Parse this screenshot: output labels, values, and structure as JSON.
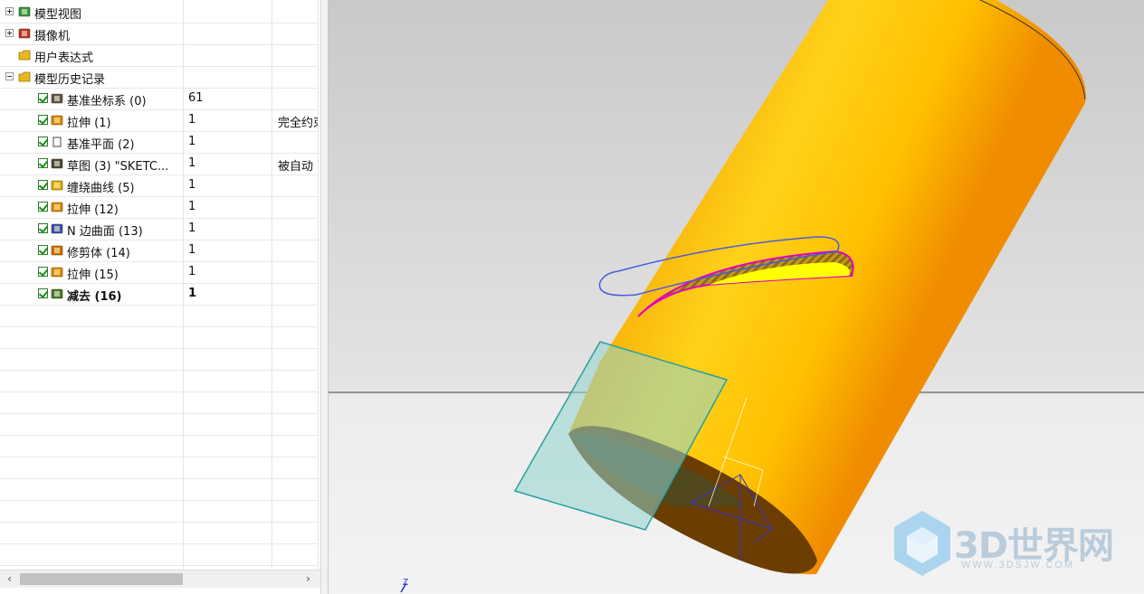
{
  "part_navigator": {
    "rows": [
      {
        "name": "模型视图",
        "update": "",
        "remark": "",
        "icon": "model-views-icon",
        "expander": "plus",
        "checked": false,
        "bold": false,
        "indent": 0
      },
      {
        "name": "摄像机",
        "update": "",
        "remark": "",
        "icon": "cameras-icon",
        "expander": "plus",
        "checked": false,
        "bold": false,
        "indent": 0
      },
      {
        "name": "用户表达式",
        "update": "",
        "remark": "",
        "icon": "folder-icon",
        "expander": "",
        "checked": false,
        "bold": false,
        "indent": 0
      },
      {
        "name": "模型历史记录",
        "update": "",
        "remark": "",
        "icon": "folder-open-icon",
        "expander": "minus",
        "checked": false,
        "bold": false,
        "indent": 0
      },
      {
        "name": "基准坐标系 (0)",
        "update": "61",
        "remark": "",
        "icon": "datum-csys-icon",
        "expander": "",
        "checked": true,
        "bold": false,
        "indent": 1
      },
      {
        "name": "拉伸 (1)",
        "update": "1",
        "remark": "完全约束",
        "icon": "extrude-icon",
        "expander": "",
        "checked": true,
        "bold": false,
        "indent": 1
      },
      {
        "name": "基准平面 (2)",
        "update": "1",
        "remark": "",
        "icon": "datum-plane-icon",
        "expander": "",
        "checked": true,
        "bold": false,
        "indent": 1
      },
      {
        "name": "草图 (3) \"SKETC...",
        "update": "1",
        "remark": "被自动",
        "icon": "sketch-icon",
        "expander": "",
        "checked": true,
        "bold": false,
        "indent": 1
      },
      {
        "name": "缠绕曲线 (5)",
        "update": "1",
        "remark": "",
        "icon": "wrap-curve-icon",
        "expander": "",
        "checked": true,
        "bold": false,
        "indent": 1
      },
      {
        "name": "拉伸 (12)",
        "update": "1",
        "remark": "",
        "icon": "extrude-icon",
        "expander": "",
        "checked": true,
        "bold": false,
        "indent": 1
      },
      {
        "name": "N 边曲面 (13)",
        "update": "1",
        "remark": "",
        "icon": "n-sided-surface-icon",
        "expander": "",
        "checked": true,
        "bold": false,
        "indent": 1
      },
      {
        "name": "修剪体 (14)",
        "update": "1",
        "remark": "",
        "icon": "trim-body-icon",
        "expander": "",
        "checked": true,
        "bold": false,
        "indent": 1
      },
      {
        "name": "拉伸 (15)",
        "update": "1",
        "remark": "",
        "icon": "extrude-icon",
        "expander": "",
        "checked": true,
        "bold": false,
        "indent": 1
      },
      {
        "name": "减去 (16)",
        "update": "1",
        "remark": "",
        "icon": "subtract-icon",
        "expander": "",
        "checked": true,
        "bold": true,
        "indent": 1
      }
    ],
    "empty_rows": 12,
    "scroll_left_label": "‹",
    "scroll_right_label": "›"
  },
  "viewport": {
    "triad_axis_label": "Z",
    "background_top": "#cfcfcf",
    "background_bottom": "#f0f0f0",
    "body_color": "#f5a000",
    "datum_plane_color": "#5fbfbf"
  },
  "watermark": {
    "title": "3D世界网",
    "url": "WWW.3DSJW.COM"
  }
}
